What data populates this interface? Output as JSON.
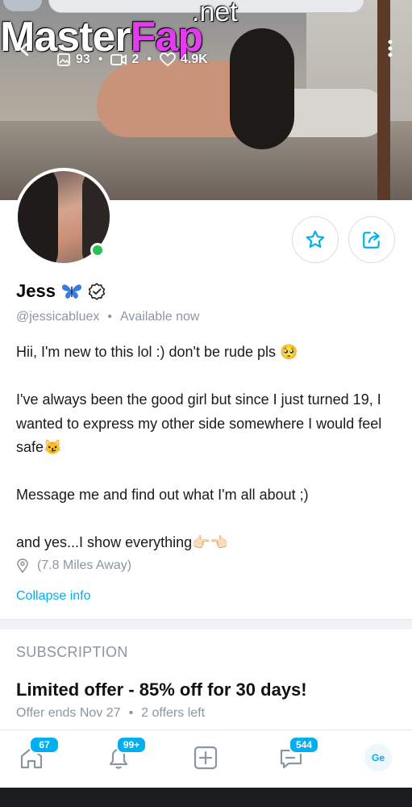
{
  "watermark": {
    "main_white": "Master",
    "main_pink": "Fap",
    "suffix": ".net"
  },
  "cover_stats": {
    "photos": "93",
    "videos": "2",
    "likes": "4.9K",
    "separator": "•"
  },
  "profile": {
    "name": "Jess",
    "handle": "@jessicabluex",
    "separator": "•",
    "status": "Available now",
    "bio": [
      "Hii, I'm new to this lol :) don't be rude pls 🥺",
      "",
      "I've always been the good girl but since I just turned 19, I wanted to express my other side somewhere I would feel safe😼",
      "",
      "Message me and find out what I'm all about ;)",
      "",
      "and yes...I show everything👉🏻👈🏻"
    ],
    "location": "(7.8 Miles Away)",
    "collapse_label": "Collapse info"
  },
  "subscription": {
    "heading": "SUBSCRIPTION",
    "offer_title": "Limited offer - 85% off for 30 days!",
    "offer_ends": "Offer ends Nov 27",
    "separator": "•",
    "offers_left": "2 offers left"
  },
  "bottom_nav": {
    "home_badge": "67",
    "notifications_badge": "99+",
    "messages_badge": "544",
    "avatar_initials": "Ge"
  },
  "colors": {
    "accent": "#00aff0",
    "online": "#2bbf5a",
    "muted": "#8a96a3",
    "watermark_pink": "#e33cf0"
  },
  "icons": [
    "back-arrow-icon",
    "image-icon",
    "video-icon",
    "heart-icon",
    "more-vertical-icon",
    "star-icon",
    "share-icon",
    "butterfly-emoji",
    "verified-icon",
    "location-pin-icon",
    "home-icon",
    "bell-icon",
    "plus-square-icon",
    "message-icon"
  ]
}
